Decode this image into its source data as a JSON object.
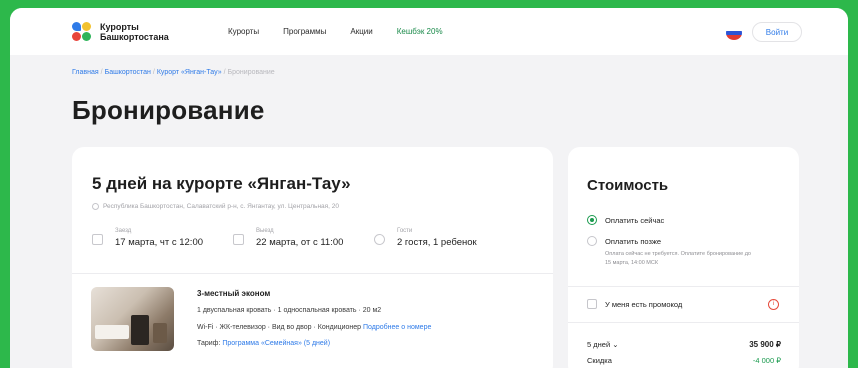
{
  "header": {
    "logo_text": "Курорты Башкортостана",
    "nav": [
      "Курорты",
      "Программы",
      "Акции",
      "Кешбэк 20%"
    ],
    "login": "Войти"
  },
  "breadcrumbs": [
    "Главная",
    "Башкортостан",
    "Курорт «Янган-Тау»",
    "Бронирование"
  ],
  "page_title": "Бронирование",
  "booking": {
    "title": "5 дней на курорте «Янган-Тау»",
    "address": "Республика Башкортостан, Салаватский р-н, с. Янгантау, ул. Центральная, 20",
    "dates": [
      {
        "label": "Заезд",
        "value": "17 марта, чт с 12:00"
      },
      {
        "label": "Выезд",
        "value": "22 марта, от с 11:00"
      },
      {
        "label": "Гости",
        "value": "2 гостя, 1 ребенок"
      }
    ],
    "room": {
      "name": "3-местный эконом",
      "beds": "1 двуспальная кровать · 1 односпальная кровать · 20 м2",
      "amenities": "Wi-Fi · ЖК-телевизор · Вид во двор · Кондиционер",
      "details_link": "Подробнее о номере",
      "tariff_label": "Тариф:",
      "tariff_link": "Программа «Семейная» (5 дней)"
    }
  },
  "cost": {
    "title": "Стоимость",
    "pay_now": "Оплатить сейчас",
    "pay_later": "Оплатить позже",
    "note": "Оплата сейчас не требуется. Оплатите бронирование до 15 марта, 14:00 МСК",
    "promo": "У меня есть промокод",
    "days_label": "5 дней",
    "days_price": "35 900 ₽",
    "discount_label": "Скидка",
    "discount_value": "-4 000 ₽"
  },
  "colors": {
    "background": "#2db84b",
    "link": "#2f7be8",
    "accent_green": "#1a9a4e"
  }
}
